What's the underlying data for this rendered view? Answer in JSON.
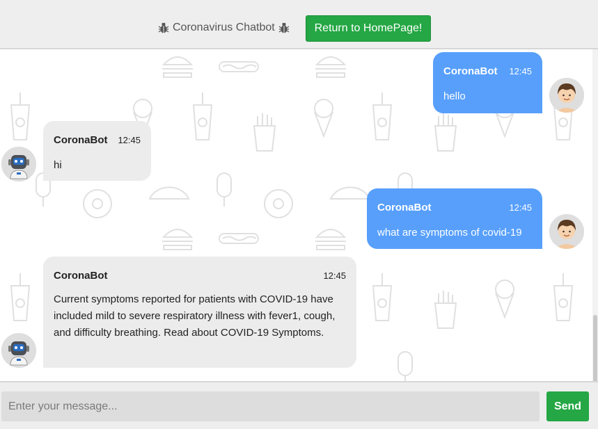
{
  "header": {
    "title": "Coronavirus Chatbot",
    "title_icon": "bug-icon",
    "return_button": "Return to HomePage!"
  },
  "background": {
    "pattern": "fast-food-doodle-icons"
  },
  "messages": [
    {
      "side": "right",
      "name": "CoronaBot",
      "time": "12:45",
      "text": "hello",
      "avatar": "user-avatar-icon"
    },
    {
      "side": "left",
      "name": "CoronaBot",
      "time": "12:45",
      "text": "hi",
      "avatar": "bot-avatar-icon"
    },
    {
      "side": "right",
      "name": "CoronaBot",
      "time": "12:45",
      "text": "what are symptoms of covid-19",
      "avatar": "user-avatar-icon"
    },
    {
      "side": "left",
      "name": "CoronaBot",
      "time": "12:45",
      "text": "Current symptoms reported for patients with COVID-19 have included mild to severe respiratory illness with fever1, cough, and difficulty breathing. Read about COVID-19 Symptoms.",
      "avatar": "bot-avatar-icon"
    }
  ],
  "input": {
    "placeholder": "Enter your message...",
    "value": "",
    "send_label": "Send"
  },
  "colors": {
    "accent": "#24a744",
    "user_bubble": "#579ffb",
    "bot_bubble": "#ececec",
    "header_bg": "#eeeeee"
  }
}
